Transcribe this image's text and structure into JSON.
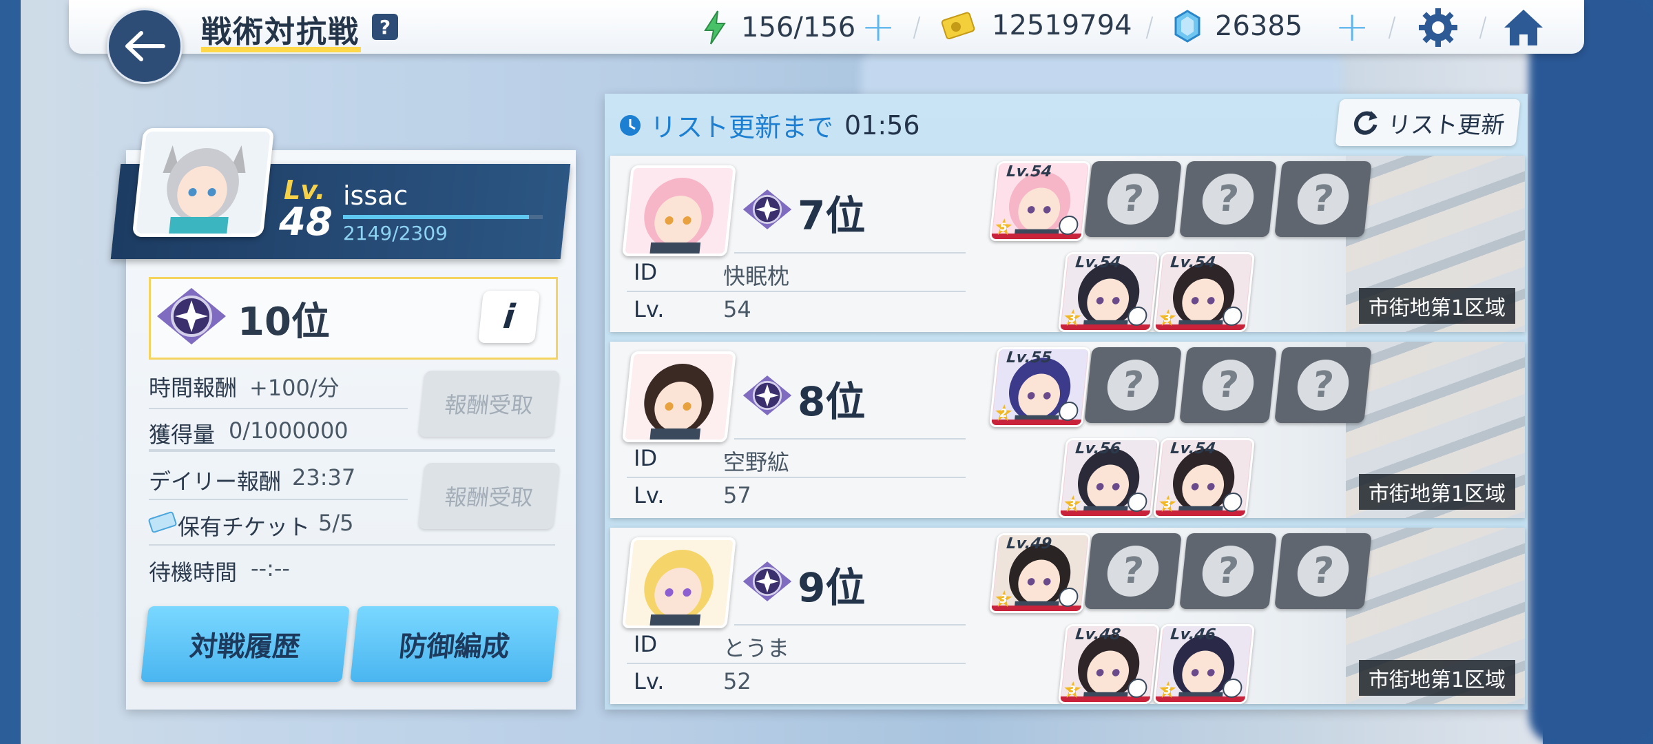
{
  "header": {
    "title": "戦術対抗戦",
    "help_label": "?",
    "stamina": "156/156",
    "credits": "12519794",
    "gems": "26385"
  },
  "player": {
    "lv_label": "Lv.",
    "level": "48",
    "name": "issac",
    "exp": "2149/2309",
    "exp_fraction": 0.93,
    "rank": "10位",
    "info_label": "i",
    "time_reward_label": "時間報酬",
    "time_reward_value": "+100/分",
    "earned_label": "獲得量",
    "earned_value": "0/1000000",
    "claim_label_1": "報酬受取",
    "daily_label": "デイリー報酬",
    "daily_value": "23:37",
    "claim_label_2": "報酬受取",
    "ticket_label": "保有チケット",
    "ticket_value": "5/5",
    "wait_label": "待機時間",
    "wait_value": "--:--",
    "history_button": "対戦履歴",
    "defense_button": "防御編成"
  },
  "list": {
    "timer_label": "リスト更新まで",
    "timer_value": "01:56",
    "refresh_label": "リスト更新"
  },
  "opponents": [
    {
      "rank": "7位",
      "id_label": "ID",
      "id": "快眠枕",
      "lv_label": "Lv.",
      "lv": "54",
      "units": [
        {
          "lv": "Lv.54",
          "star": "5"
        },
        {
          "lv": "Lv.54",
          "star": "3"
        },
        {
          "lv": "Lv.54",
          "star": "3"
        }
      ],
      "zone": "市街地第1区域"
    },
    {
      "rank": "8位",
      "id_label": "ID",
      "id": "空野絋",
      "lv_label": "Lv.",
      "lv": "57",
      "units": [
        {
          "lv": "Lv.55",
          "star": "2"
        },
        {
          "lv": "Lv.56",
          "star": "3"
        },
        {
          "lv": "Lv.54",
          "star": "3"
        }
      ],
      "zone": "市街地第1区域"
    },
    {
      "rank": "9位",
      "id_label": "ID",
      "id": "とうま",
      "lv_label": "Lv.",
      "lv": "52",
      "units": [
        {
          "lv": "Lv.49",
          "star": "3"
        },
        {
          "lv": "Lv.48",
          "star": "3"
        },
        {
          "lv": "Lv.46",
          "star": "3"
        }
      ],
      "zone": "市街地第1区域"
    }
  ],
  "empty_slot_label": "?"
}
